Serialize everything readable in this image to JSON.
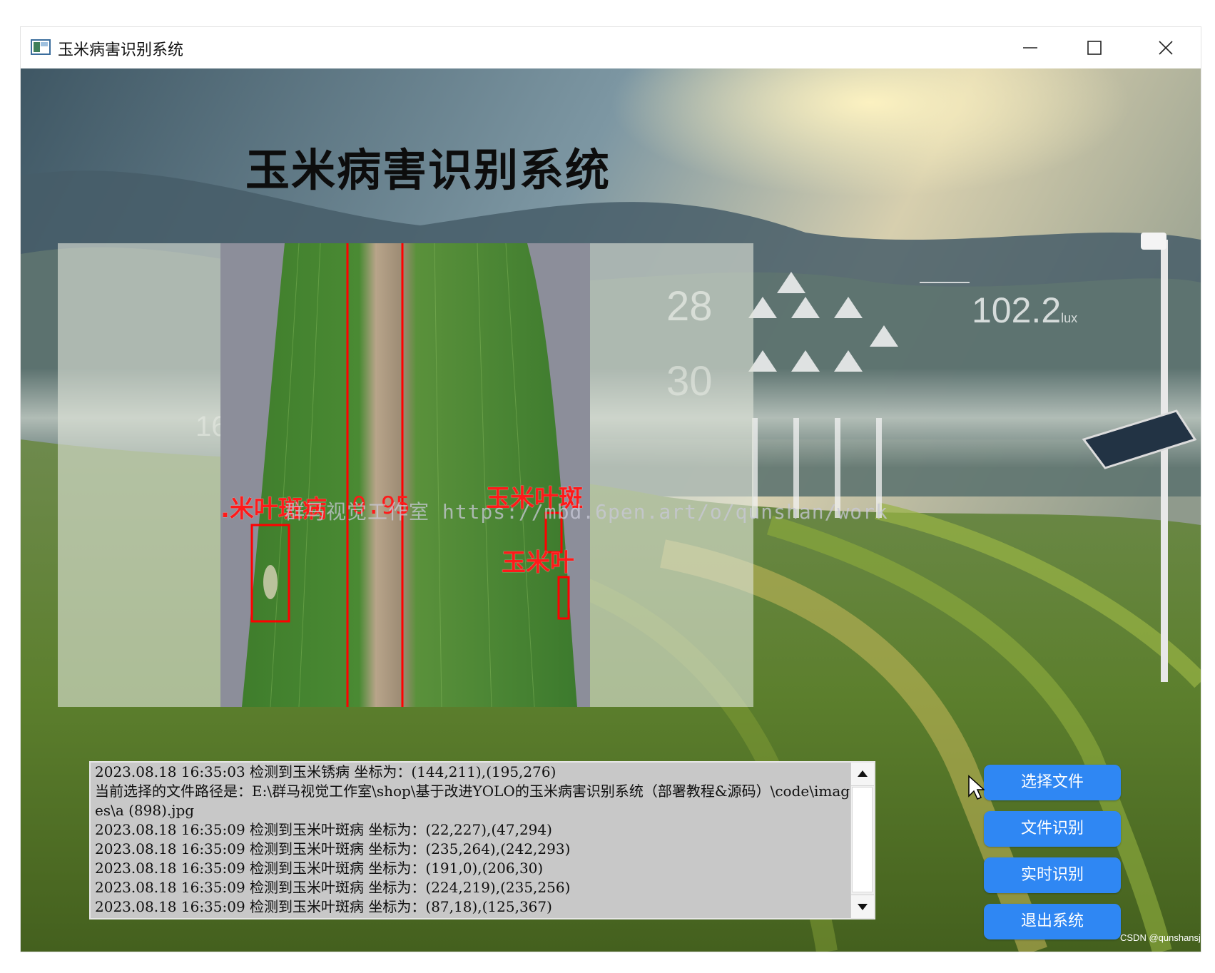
{
  "window": {
    "title": "玉米病害识别系统"
  },
  "app": {
    "title": "玉米病害识别系统"
  },
  "overlay": {
    "temp_value": "28",
    "temp_value2": "30",
    "light_value": "102.2",
    "light_unit": "lux",
    "side_value": "16"
  },
  "detections": [
    {
      "label": ".米叶斑病",
      "score": "0.95"
    },
    {
      "label": "玉米叶斑"
    },
    {
      "label": "玉米叶"
    }
  ],
  "watermark": "群马视觉工作室 https://mbd.6pen.art/o/qunshan/work",
  "log": {
    "lines": [
      "2023.08.18 16:35:03 检测到玉米锈病 坐标为：(144,211),(195,276)",
      "当前选择的文件路径是：E:\\群马视觉工作室\\shop\\基于改进YOLO的玉米病害识别系统（部署教程&源码）\\code\\images\\a (898).jpg",
      "2023.08.18 16:35:09 检测到玉米叶斑病 坐标为：(22,227),(47,294)",
      "2023.08.18 16:35:09 检测到玉米叶斑病 坐标为：(235,264),(242,293)",
      "2023.08.18 16:35:09 检测到玉米叶斑病 坐标为：(191,0),(206,30)",
      "2023.08.18 16:35:09 检测到玉米叶斑病 坐标为：(224,219),(235,256)",
      "2023.08.18 16:35:09 检测到玉米叶斑病 坐标为：(87,18),(125,367)"
    ]
  },
  "buttons": {
    "select_file": "选择文件",
    "file_detect": "文件识别",
    "realtime": "实时识别",
    "exit": "退出系统"
  },
  "credit": "CSDN @qunshansj",
  "colors": {
    "button": "#2f87f3",
    "detection": "#ff1a1a",
    "log_bg": "#c8c8c8"
  }
}
